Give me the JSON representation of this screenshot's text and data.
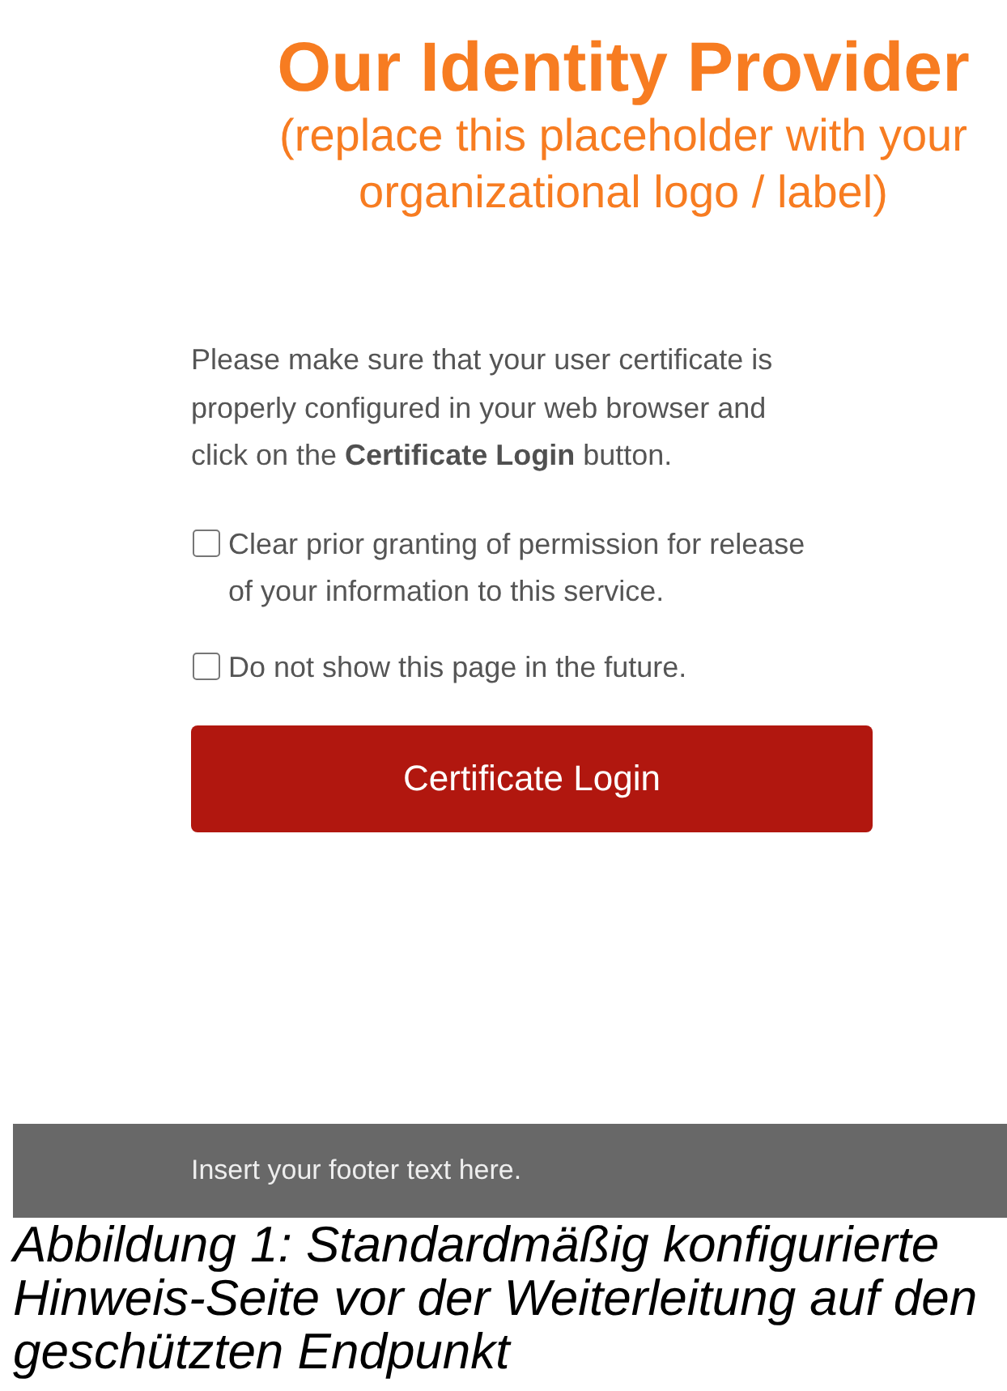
{
  "header": {
    "title": "Our Identity Provider",
    "subtitle": "(replace this placeholder with your organizational logo / label)"
  },
  "intro": "Please make sure that your user certificate is properly configured in your web browser and click on the **Certificate Login** button.",
  "options": [
    {
      "label": "Clear prior granting of permission for release of your information to this service.",
      "checked": false
    },
    {
      "label": "Do not show this page in the future.",
      "checked": false
    }
  ],
  "login_button": "Certificate Login",
  "footer": "Insert your footer text here.",
  "caption": "Abbildung 1: Standardmäßig konfigurierte Hinweis-Seite vor der Weiterleitung auf den geschützten Endpunkt"
}
